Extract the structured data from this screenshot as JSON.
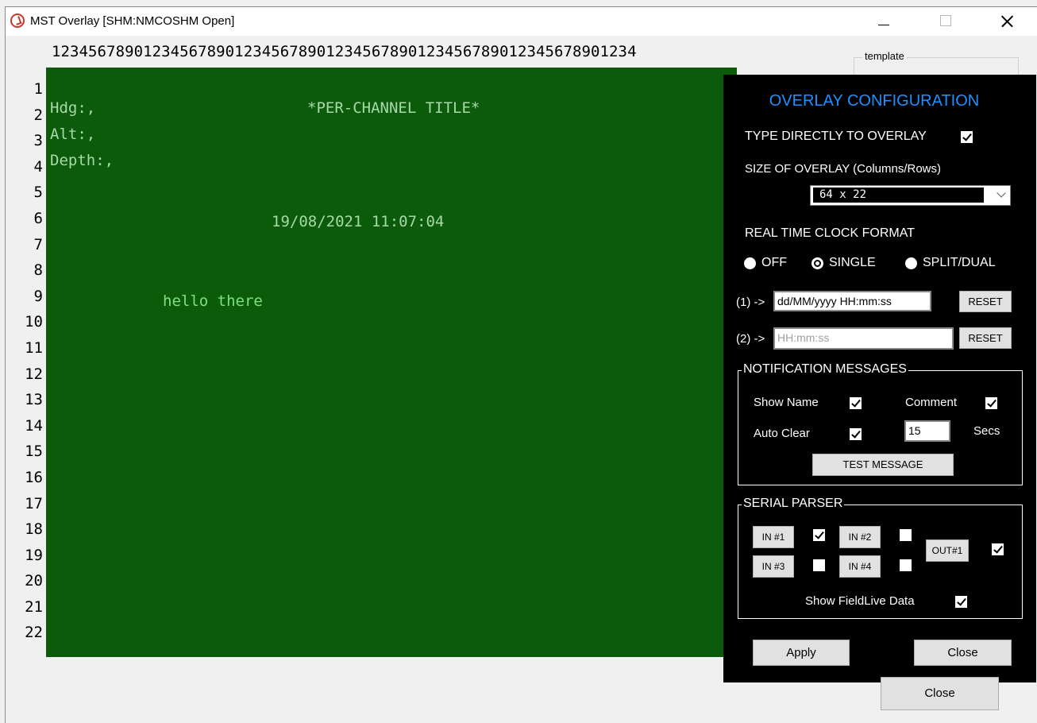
{
  "window": {
    "title": "MST Overlay  [SHM:NMCOSHM Open]"
  },
  "ruler": {
    "columns": "1234567890123456789012345678901234567890123456789012345678901234"
  },
  "rows": [
    "1",
    "2",
    "3",
    "4",
    "5",
    "6",
    "7",
    "8",
    "9",
    "10",
    "11",
    "12",
    "13",
    "14",
    "15",
    "16",
    "17",
    "18",
    "19",
    "20",
    "21",
    "22"
  ],
  "template_group": {
    "label": "template"
  },
  "overlay": {
    "line2_left": "Hdg:,",
    "line2_title": "*PER-CHANNEL TITLE*",
    "line3": "Alt:,",
    "line4": "Depth:,",
    "line6_clock": "19/08/2021 11:07:04",
    "line9_text": "hello there"
  },
  "config": {
    "title": "OVERLAY CONFIGURATION",
    "type_direct_label": "TYPE DIRECTLY TO OVERLAY",
    "type_direct_checked": true,
    "size_label": "SIZE OF OVERLAY (Columns/Rows)",
    "size_value": "64 x 22",
    "clock_label": "REAL TIME CLOCK FORMAT",
    "clock_options": [
      "OFF",
      "SINGLE",
      "SPLIT/DUAL"
    ],
    "clock_selected": "SINGLE",
    "format1_label": "(1) ->",
    "format1_value": "dd/MM/yyyy HH:mm:ss",
    "format2_label": "(2) ->",
    "format2_value": "HH:mm:ss",
    "reset_label": "RESET",
    "notif": {
      "legend": "NOTIFICATION MESSAGES",
      "show_name": "Show Name",
      "comment": "Comment",
      "auto_clear": "Auto Clear",
      "secs_value": "15",
      "secs_label": "Secs",
      "test_button": "TEST MESSAGE"
    },
    "serial": {
      "legend": "SERIAL PARSER",
      "in1": "IN #1",
      "in2": "IN #2",
      "in3": "IN #3",
      "in4": "IN #4",
      "out1": "OUT#1",
      "fieldlive": "Show FieldLive Data"
    },
    "apply": "Apply",
    "close": "Close"
  },
  "outer_close": "Close"
}
